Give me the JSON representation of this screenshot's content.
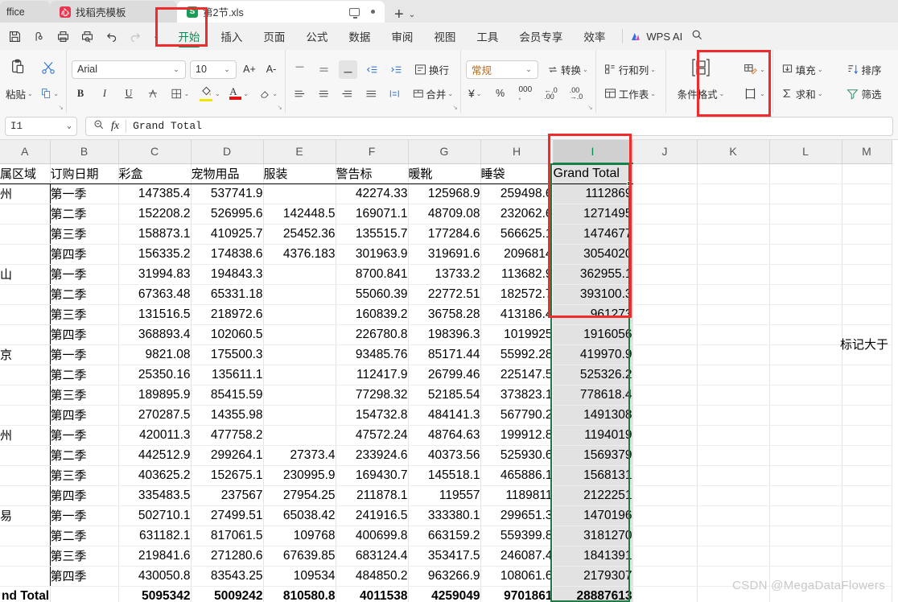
{
  "window": {
    "tabs": [
      {
        "label": "ffice",
        "icon": "office-icon",
        "active": false
      },
      {
        "label": "找稻壳模板",
        "icon": "docer-icon",
        "active": false
      },
      {
        "label": "第2节.xls",
        "icon": "spreadsheet-icon",
        "active": true
      }
    ],
    "new_tab_label": "+",
    "tab_menu_caret": "⌄"
  },
  "quick_access": [
    "save-icon",
    "cloud-sync-icon",
    "print-icon",
    "print-preview-icon",
    "undo-icon",
    "redo-icon",
    "customize-caret-icon"
  ],
  "ribbon_tabs": [
    {
      "label": "开始",
      "selected": true
    },
    {
      "label": "插入",
      "selected": false
    },
    {
      "label": "页面",
      "selected": false
    },
    {
      "label": "公式",
      "selected": false
    },
    {
      "label": "数据",
      "selected": false
    },
    {
      "label": "审阅",
      "selected": false
    },
    {
      "label": "视图",
      "selected": false
    },
    {
      "label": "工具",
      "selected": false
    },
    {
      "label": "会员专享",
      "selected": false
    },
    {
      "label": "效率",
      "selected": false
    }
  ],
  "wps_ai": {
    "label": "WPS AI",
    "search_icon": "search-icon"
  },
  "ribbon": {
    "clipboard": {
      "paste_label": "粘贴",
      "cut_icon": "scissors-icon",
      "clipboard_icon": "clipboard-icon",
      "copy_icon": "copy-icon"
    },
    "font": {
      "font_name": "Arial",
      "font_size": "10",
      "grow_label": "A+",
      "shrink_label": "A-",
      "bold": "B",
      "italic": "I",
      "underline": "U",
      "strike_icon": "strikethrough-icon",
      "borders_icon": "borders-icon",
      "fill_color_icon": "fill-color-icon",
      "font_color_icon": "font-color-icon",
      "clear_format_icon": "clear-format-icon"
    },
    "alignment": {
      "wrap_label": "换行",
      "merge_label": "合并",
      "align_top_icon": "align-top-icon",
      "align_middle_icon": "align-middle-icon",
      "align_bottom_icon": "align-bottom-icon",
      "decrease_indent_icon": "decrease-indent-icon",
      "increase_indent_icon": "increase-indent-icon",
      "align_left_icon": "align-left-icon",
      "align_center_icon": "align-center-icon",
      "align_right_icon": "align-right-icon",
      "justify_icon": "justify-icon",
      "orientation_icon": "text-orientation-icon"
    },
    "number": {
      "format_name": "常规",
      "convert_label": "转换",
      "currency_icon": "currency-icon",
      "percent_label": "%",
      "comma_icon": "comma-style-icon",
      "increase_decimal_icon": "increase-decimal-icon",
      "decrease_decimal_icon": "decrease-decimal-icon"
    },
    "cells": {
      "rows_cols_label": "行和列",
      "worksheet_label": "工作表"
    },
    "styles": {
      "conditional_format_label": "条件格式",
      "cell_style_icon": "cell-style-icon",
      "table_style_icon": "table-style-icon"
    },
    "editing": {
      "fill_label": "填充",
      "sum_label": "求和",
      "sort_label": "排序",
      "filter_label": "筛选"
    }
  },
  "formula_bar": {
    "name_box": "I1",
    "zoom_icon": "zoom-out-icon",
    "fx_icon": "fx-icon",
    "content": "Grand Total"
  },
  "sheet": {
    "columns": [
      "A",
      "B",
      "C",
      "D",
      "E",
      "F",
      "G",
      "H",
      "I",
      "J",
      "K",
      "L",
      "M"
    ],
    "selected_column": "I",
    "headers": [
      "属区域",
      "订购日期",
      "彩盒",
      "宠物用品",
      "服装",
      "警告标",
      "暖靴",
      "睡袋",
      "Grand Total",
      "",
      "",
      "",
      ""
    ],
    "annotation_note": "标记大于",
    "watermark": "CSDN @MegaDataFlowers",
    "grand_total_label": "nd Total",
    "rows": [
      {
        "region": "州",
        "group_start": true,
        "quarter": "第一季",
        "values": [
          "147385.4",
          "537741.9",
          "",
          "42274.33",
          "125968.9",
          "259498.6",
          "1112869"
        ]
      },
      {
        "region": "",
        "group_start": false,
        "quarter": "第二季",
        "values": [
          "152208.2",
          "526995.6",
          "142448.5",
          "169071.1",
          "48709.08",
          "232062.6",
          "1271495"
        ]
      },
      {
        "region": "",
        "group_start": false,
        "quarter": "第三季",
        "values": [
          "158873.1",
          "410925.7",
          "25452.36",
          "135515.7",
          "177284.6",
          "566625.1",
          "1474677"
        ]
      },
      {
        "region": "",
        "group_start": false,
        "quarter": "第四季",
        "values": [
          "156335.2",
          "174838.6",
          "4376.183",
          "301963.9",
          "319691.6",
          "2096814",
          "3054020"
        ]
      },
      {
        "region": "山",
        "group_start": true,
        "quarter": "第一季",
        "values": [
          "31994.83",
          "194843.3",
          "",
          "8700.841",
          "13733.2",
          "113682.9",
          "362955.1"
        ]
      },
      {
        "region": "",
        "group_start": false,
        "quarter": "第二季",
        "values": [
          "67363.48",
          "65331.18",
          "",
          "55060.39",
          "22772.51",
          "182572.7",
          "393100.3"
        ]
      },
      {
        "region": "",
        "group_start": false,
        "quarter": "第三季",
        "values": [
          "131516.5",
          "218972.6",
          "",
          "160839.2",
          "36758.28",
          "413186.4",
          "961273"
        ]
      },
      {
        "region": "",
        "group_start": false,
        "quarter": "第四季",
        "values": [
          "368893.4",
          "102060.5",
          "",
          "226780.8",
          "198396.3",
          "1019925",
          "1916056"
        ]
      },
      {
        "region": "京",
        "group_start": true,
        "quarter": "第一季",
        "values": [
          "9821.08",
          "175500.3",
          "",
          "93485.76",
          "85171.44",
          "55992.28",
          "419970.9"
        ]
      },
      {
        "region": "",
        "group_start": false,
        "quarter": "第二季",
        "values": [
          "25350.16",
          "135611.1",
          "",
          "112417.9",
          "26799.46",
          "225147.5",
          "525326.2"
        ]
      },
      {
        "region": "",
        "group_start": false,
        "quarter": "第三季",
        "values": [
          "189895.9",
          "85415.59",
          "",
          "77298.32",
          "52185.54",
          "373823.1",
          "778618.4"
        ]
      },
      {
        "region": "",
        "group_start": false,
        "quarter": "第四季",
        "values": [
          "270287.5",
          "14355.98",
          "",
          "154732.8",
          "484141.3",
          "567790.2",
          "1491308"
        ]
      },
      {
        "region": "州",
        "group_start": true,
        "quarter": "第一季",
        "values": [
          "420011.3",
          "477758.2",
          "",
          "47572.24",
          "48764.63",
          "199912.8",
          "1194019"
        ]
      },
      {
        "region": "",
        "group_start": false,
        "quarter": "第二季",
        "values": [
          "442512.9",
          "299264.1",
          "27373.4",
          "233924.6",
          "40373.56",
          "525930.6",
          "1569379"
        ]
      },
      {
        "region": "",
        "group_start": false,
        "quarter": "第三季",
        "values": [
          "403625.2",
          "152675.1",
          "230995.9",
          "169430.7",
          "145518.1",
          "465886.1",
          "1568131"
        ]
      },
      {
        "region": "",
        "group_start": false,
        "quarter": "第四季",
        "values": [
          "335483.5",
          "237567",
          "27954.25",
          "211878.1",
          "119557",
          "1189811",
          "2122251"
        ]
      },
      {
        "region": "易",
        "group_start": true,
        "quarter": "第一季",
        "values": [
          "502710.1",
          "27499.51",
          "65038.42",
          "241916.5",
          "333380.1",
          "299651.3",
          "1470196"
        ]
      },
      {
        "region": "",
        "group_start": false,
        "quarter": "第二季",
        "values": [
          "631182.1",
          "817061.5",
          "109768",
          "400699.8",
          "663159.2",
          "559399.8",
          "3181270"
        ]
      },
      {
        "region": "",
        "group_start": false,
        "quarter": "第三季",
        "values": [
          "219841.6",
          "271280.6",
          "67639.85",
          "683124.4",
          "353417.5",
          "246087.4",
          "1841391"
        ]
      },
      {
        "region": "",
        "group_start": false,
        "quarter": "第四季",
        "values": [
          "430050.8",
          "83543.25",
          "109534",
          "484850.2",
          "963266.9",
          "108061.6",
          "2179307"
        ]
      }
    ],
    "grand_total_values": [
      "5095342",
      "5009242",
      "810580.8",
      "4011538",
      "4259049",
      "9701861",
      "28887613"
    ]
  },
  "colors": {
    "accent_green": "#0b8a52",
    "annotation_red": "#ef2b2b",
    "selection_green": "#1f7a44",
    "header_gray": "#efefef"
  }
}
